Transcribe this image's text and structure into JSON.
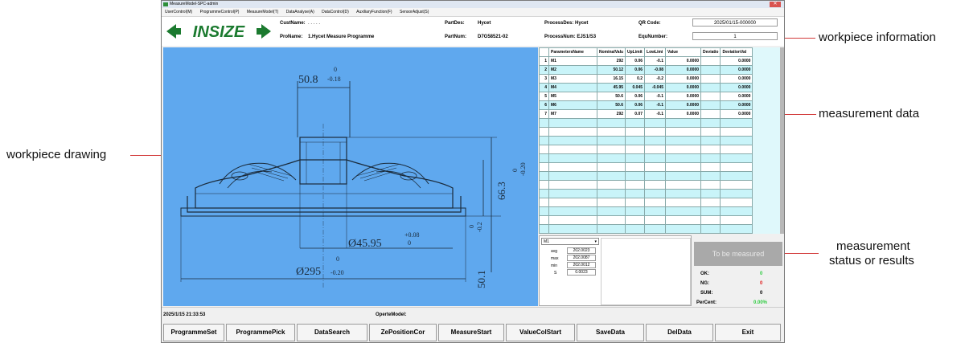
{
  "window": {
    "title": "MeasureModel-SPC-admin",
    "menu": [
      "UserControl(M)",
      "ProgrammeControl(P)",
      "MeasureModel(T)",
      "DataAnalyse(A)",
      "DataControl(D)",
      "AuxiliaryFunction(F)",
      "SensorAdjust(S)"
    ]
  },
  "header": {
    "logo_text": "INSIZE",
    "cust_name_label": "CustName:",
    "cust_name_value": ". . . . .",
    "pro_name_label": "ProName:",
    "pro_name_value": "1.Hycet Measure Programme",
    "part_des_label": "PartDes:",
    "part_des_value": "Hycet",
    "part_num_label": "PartNum:",
    "part_num_value": "D7G58521-02",
    "process_des_label": "ProcessDes: Hycet",
    "process_num_label": "ProcessNum: EJS1/S3",
    "qr_label": "QR Code:",
    "qr_value": "2025/01/15-000000",
    "equ_label": "EquNumber:",
    "equ_value": "1"
  },
  "drawing": {
    "dim_top": "50.8",
    "dim_top_tol_upper": "0",
    "dim_top_tol_lower": "-0.18",
    "dim_mid": "Ø45.95",
    "dim_mid_tol_upper": "+0.08",
    "dim_mid_tol_lower": "0",
    "dim_bottom": "Ø295",
    "dim_bottom_tol_upper": "0",
    "dim_bottom_tol_lower": "-0.20",
    "dim_right_1": "66.3",
    "dim_right_1_tol_upper": "0",
    "dim_right_1_tol_lower": "-0.20",
    "dim_right_2": "50.1",
    "dim_right_2_tol_upper": "0",
    "dim_right_2_tol_lower": "-0.2"
  },
  "table": {
    "headers": [
      "",
      "ParametersName",
      "NominalValu",
      "UpLimit",
      "LowLimi",
      "Value",
      "Deviatio",
      "DeviationVal"
    ],
    "rows": [
      [
        "1",
        "M1",
        "292",
        "0.06",
        "-0.1",
        "0.0000",
        "",
        "0.0000"
      ],
      [
        "2",
        "M2",
        "50.12",
        "0.06",
        "-0.08",
        "0.0000",
        "",
        "0.0000"
      ],
      [
        "3",
        "M3",
        "16.15",
        "0.2",
        "-0.2",
        "0.0000",
        "",
        "0.0000"
      ],
      [
        "4",
        "M4",
        "45.95",
        "0.045",
        "-0.045",
        "0.0000",
        "",
        "0.0000"
      ],
      [
        "5",
        "M5",
        "50.6",
        "0.06",
        "-0.1",
        "0.0000",
        "",
        "0.0000"
      ],
      [
        "6",
        "M6",
        "50.6",
        "0.06",
        "-0.1",
        "0.0000",
        "",
        "0.0000"
      ],
      [
        "7",
        "M7",
        "292",
        "0.07",
        "-0.1",
        "0.0000",
        "",
        "0.0000"
      ]
    ]
  },
  "stats": {
    "selected": "M1",
    "avg_label": "avg",
    "avg_value": "202.0023",
    "max_label": "max",
    "max_value": "202.0087",
    "min_label": "min",
    "min_value": "202.0012",
    "s_label": "S",
    "s_value": "0.0023"
  },
  "status": {
    "text": "To be measured",
    "ok_label": "OK:",
    "ok_value": "0",
    "ng_label": "NG:",
    "ng_value": "0",
    "sum_label": "SUM:",
    "sum_value": "0",
    "percent_label": "PerCent:",
    "percent_value": "0.00%",
    "ok_color": "#2ecc40",
    "ng_color": "#e02020",
    "percent_color": "#2ecc40"
  },
  "footer": {
    "datetime": "2025/1/15 21:33:53",
    "mode": "OperteModel:"
  },
  "buttons": [
    "ProgrammeSet",
    "ProgrammePick",
    "DataSearch",
    "ZePositionCor",
    "MeasureStart",
    "ValueColStart",
    "SaveData",
    "DelData",
    "Exit"
  ],
  "annotations": {
    "workpiece_info": "workpiece information",
    "measurement_data": "measurement data",
    "workpiece_drawing": "workpiece drawing",
    "measurement_status_line1": "measurement",
    "measurement_status_line2": "status or results"
  },
  "colors": {
    "drawing_bg": "#5fa8ee",
    "logo": "#1b7a2f",
    "leader_line": "#d23a3a"
  }
}
